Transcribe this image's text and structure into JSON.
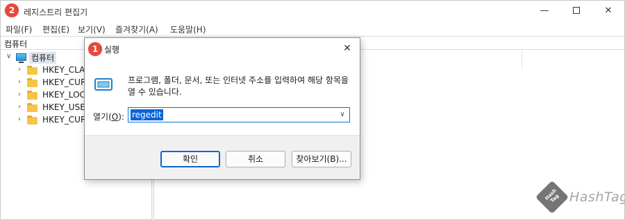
{
  "regedit": {
    "title": "레지스트리 편집기",
    "window_controls": {
      "minimize": "—",
      "close": "✕"
    },
    "menu": [
      "파일(F)",
      "편집(E)",
      "보기(V)",
      "즐겨찾기(A)",
      "도움말(H)"
    ],
    "address": "컴퓨터",
    "tree": {
      "root": "컴퓨터",
      "keys": [
        "HKEY_CLAS",
        "HKEY_CURR",
        "HKEY_LOCA",
        "HKEY_USER",
        "HKEY_CURR"
      ]
    }
  },
  "run_dialog": {
    "title": "실행",
    "close": "✕",
    "description": "프로그램, 폴더, 문서, 또는 인터넷 주소를 입력하여 해당 항목을 열 수 있습니다.",
    "open_label_prefix": "열기(",
    "open_label_key": "O",
    "open_label_suffix": "):",
    "open_value": "regedit",
    "buttons": {
      "ok": "확인",
      "cancel": "취소",
      "browse": "찾아보기(B)..."
    }
  },
  "badges": {
    "first": "1",
    "second": "2"
  },
  "accent_colors": {
    "badge": "#e8473a",
    "selection": "#0a64d8",
    "folder": "#f6c547"
  },
  "icons": [
    "folder-icon",
    "computer-icon",
    "run-icon",
    "chevron-down-icon",
    "close-icon"
  ],
  "watermark": {
    "logo": "Hash Tag",
    "text": "HashTag"
  }
}
